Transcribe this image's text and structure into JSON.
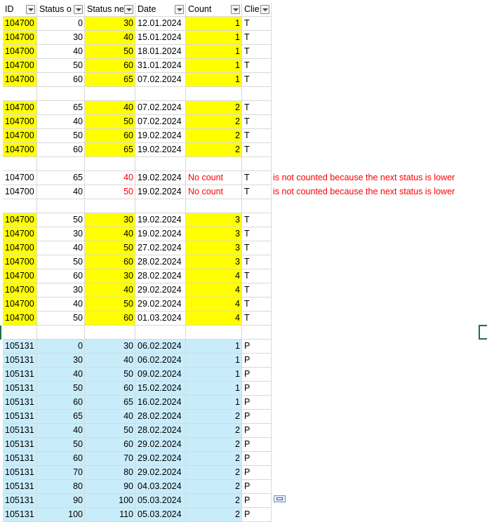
{
  "headers": [
    {
      "label": "ID",
      "name": "id"
    },
    {
      "label": "Status o",
      "name": "status-old"
    },
    {
      "label": "Status ne",
      "name": "status-new"
    },
    {
      "label": "Date",
      "name": "date"
    },
    {
      "label": "Count",
      "name": "count"
    },
    {
      "label": "Clie",
      "name": "client"
    }
  ],
  "rows": [
    {
      "id": "104700",
      "old": "0",
      "new": "30",
      "date": "12.01.2024",
      "count": "1",
      "client": "T",
      "fill": "yellow"
    },
    {
      "id": "104700",
      "old": "30",
      "new": "40",
      "date": "15.01.2024",
      "count": "1",
      "client": "T",
      "fill": "yellow"
    },
    {
      "id": "104700",
      "old": "40",
      "new": "50",
      "date": "18.01.2024",
      "count": "1",
      "client": "T",
      "fill": "yellow"
    },
    {
      "id": "104700",
      "old": "50",
      "new": "60",
      "date": "31.01.2024",
      "count": "1",
      "client": "T",
      "fill": "yellow"
    },
    {
      "id": "104700",
      "old": "60",
      "new": "65",
      "date": "07.02.2024",
      "count": "1",
      "client": "T",
      "fill": "yellow"
    },
    {
      "id": "",
      "old": "",
      "new": "",
      "date": "",
      "count": "",
      "client": "",
      "fill": "none"
    },
    {
      "id": "104700",
      "old": "65",
      "new": "40",
      "date": "07.02.2024",
      "count": "2",
      "client": "T",
      "fill": "yellow"
    },
    {
      "id": "104700",
      "old": "40",
      "new": "50",
      "date": "07.02.2024",
      "count": "2",
      "client": "T",
      "fill": "yellow"
    },
    {
      "id": "104700",
      "old": "50",
      "new": "60",
      "date": "19.02.2024",
      "count": "2",
      "client": "T",
      "fill": "yellow"
    },
    {
      "id": "104700",
      "old": "60",
      "new": "65",
      "date": "19.02.2024",
      "count": "2",
      "client": "T",
      "fill": "yellow"
    },
    {
      "id": "",
      "old": "",
      "new": "",
      "date": "",
      "count": "",
      "client": "",
      "fill": "none"
    },
    {
      "id": "104700",
      "old": "65",
      "new": "40",
      "date": "19.02.2024",
      "count": "No count",
      "client": "T",
      "fill": "none",
      "red": true,
      "note": "is not counted because the next status is lower"
    },
    {
      "id": "104700",
      "old": "40",
      "new": "50",
      "date": "19.02.2024",
      "count": "No count",
      "client": "T",
      "fill": "none",
      "red": true,
      "note": "is not counted because the next status is lower"
    },
    {
      "id": "",
      "old": "",
      "new": "",
      "date": "",
      "count": "",
      "client": "",
      "fill": "none"
    },
    {
      "id": "104700",
      "old": "50",
      "new": "30",
      "date": "19.02.2024",
      "count": "3",
      "client": "T",
      "fill": "yellow"
    },
    {
      "id": "104700",
      "old": "30",
      "new": "40",
      "date": "19.02.2024",
      "count": "3",
      "client": "T",
      "fill": "yellow"
    },
    {
      "id": "104700",
      "old": "40",
      "new": "50",
      "date": "27.02.2024",
      "count": "3",
      "client": "T",
      "fill": "yellow"
    },
    {
      "id": "104700",
      "old": "50",
      "new": "60",
      "date": "28.02.2024",
      "count": "3",
      "client": "T",
      "fill": "yellow"
    },
    {
      "id": "104700",
      "old": "60",
      "new": "30",
      "date": "28.02.2024",
      "count": "4",
      "client": "T",
      "fill": "yellow"
    },
    {
      "id": "104700",
      "old": "30",
      "new": "40",
      "date": "29.02.2024",
      "count": "4",
      "client": "T",
      "fill": "yellow"
    },
    {
      "id": "104700",
      "old": "40",
      "new": "50",
      "date": "29.02.2024",
      "count": "4",
      "client": "T",
      "fill": "yellow"
    },
    {
      "id": "104700",
      "old": "50",
      "new": "60",
      "date": "01.03.2024",
      "count": "4",
      "client": "T",
      "fill": "yellow"
    },
    {
      "id": "",
      "old": "",
      "new": "",
      "date": "",
      "count": "",
      "client": "",
      "fill": "none"
    },
    {
      "id": "105131",
      "old": "0",
      "new": "30",
      "date": "06.02.2024",
      "count": "1",
      "client": "P",
      "fill": "blue"
    },
    {
      "id": "105131",
      "old": "30",
      "new": "40",
      "date": "06.02.2024",
      "count": "1",
      "client": "P",
      "fill": "blue"
    },
    {
      "id": "105131",
      "old": "40",
      "new": "50",
      "date": "09.02.2024",
      "count": "1",
      "client": "P",
      "fill": "blue"
    },
    {
      "id": "105131",
      "old": "50",
      "new": "60",
      "date": "15.02.2024",
      "count": "1",
      "client": "P",
      "fill": "blue"
    },
    {
      "id": "105131",
      "old": "60",
      "new": "65",
      "date": "16.02.2024",
      "count": "1",
      "client": "P",
      "fill": "blue"
    },
    {
      "id": "105131",
      "old": "65",
      "new": "40",
      "date": "28.02.2024",
      "count": "2",
      "client": "P",
      "fill": "blue"
    },
    {
      "id": "105131",
      "old": "40",
      "new": "50",
      "date": "28.02.2024",
      "count": "2",
      "client": "P",
      "fill": "blue"
    },
    {
      "id": "105131",
      "old": "50",
      "new": "60",
      "date": "29.02.2024",
      "count": "2",
      "client": "P",
      "fill": "blue"
    },
    {
      "id": "105131",
      "old": "60",
      "new": "70",
      "date": "29.02.2024",
      "count": "2",
      "client": "P",
      "fill": "blue"
    },
    {
      "id": "105131",
      "old": "70",
      "new": "80",
      "date": "29.02.2024",
      "count": "2",
      "client": "P",
      "fill": "blue"
    },
    {
      "id": "105131",
      "old": "80",
      "new": "90",
      "date": "04.03.2024",
      "count": "2",
      "client": "P",
      "fill": "blue"
    },
    {
      "id": "105131",
      "old": "90",
      "new": "100",
      "date": "05.03.2024",
      "count": "2",
      "client": "P",
      "fill": "blue"
    },
    {
      "id": "105131",
      "old": "100",
      "new": "110",
      "date": "05.03.2024",
      "count": "2",
      "client": "P",
      "fill": "blue"
    }
  ]
}
